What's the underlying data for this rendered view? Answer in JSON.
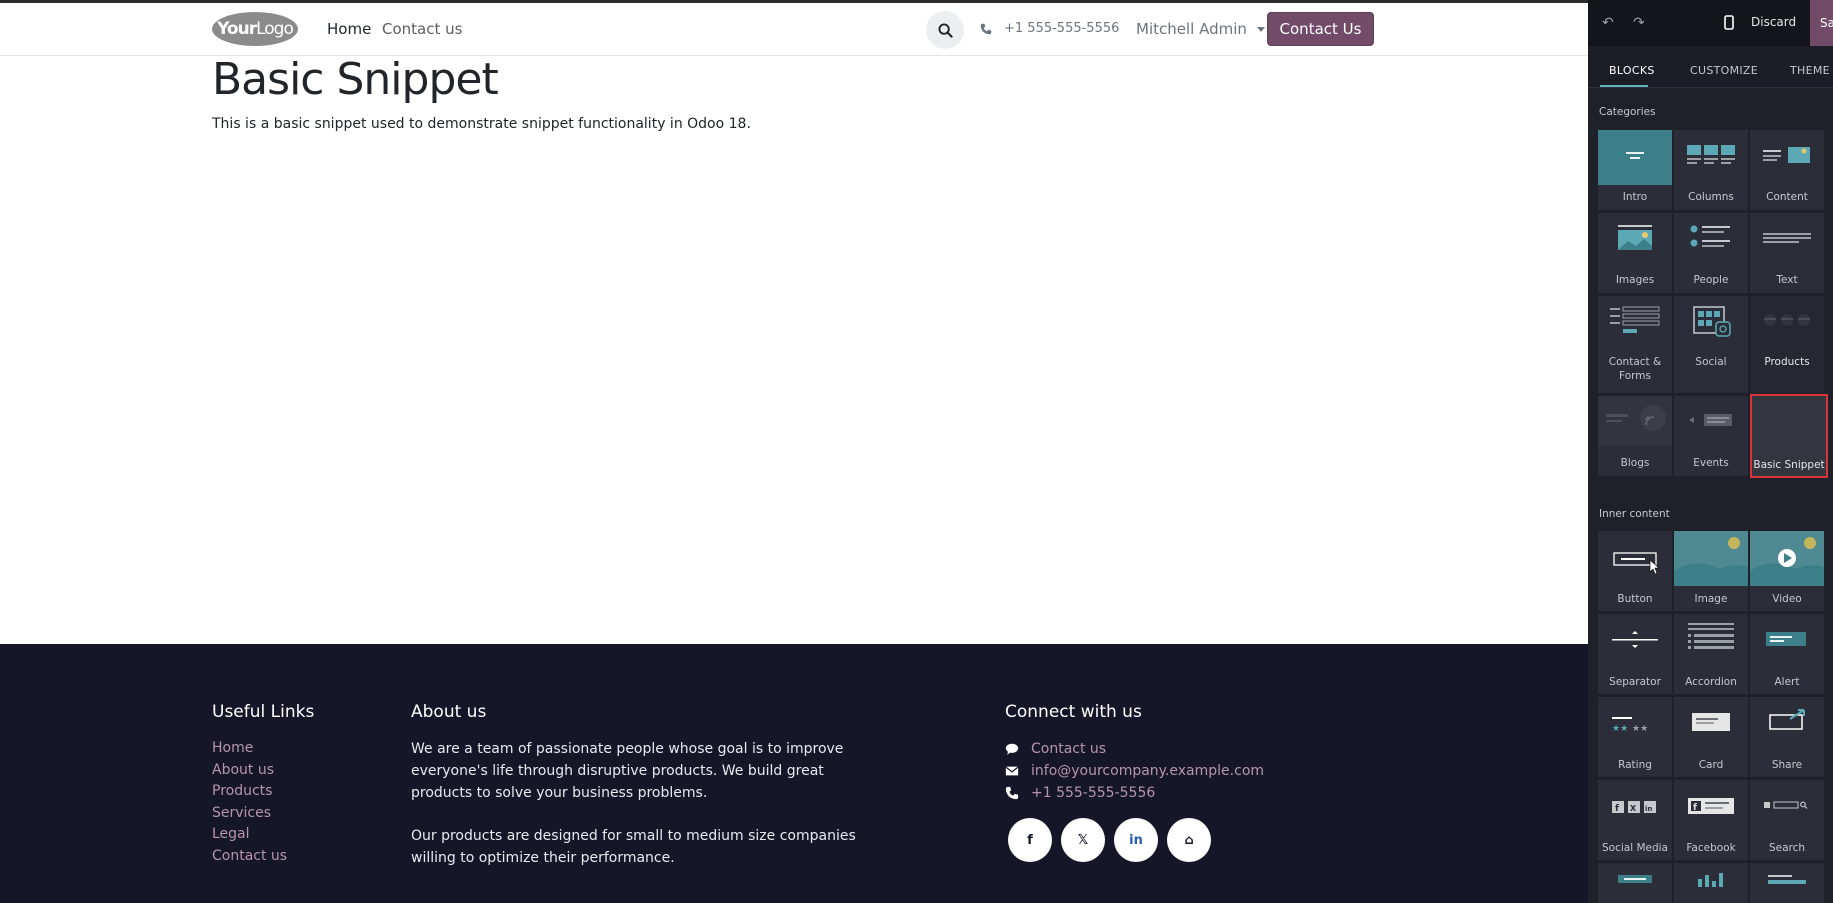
{
  "header": {
    "logo": {
      "bold": "Your",
      "rest": "Logo"
    },
    "nav": [
      {
        "label": "Home"
      },
      {
        "label": "Contact us"
      }
    ],
    "phone": "+1 555-555-5556",
    "user": "Mitchell Admin",
    "cta": "Contact Us"
  },
  "content": {
    "title": "Basic Snippet",
    "text": "This is a basic snippet used to demonstrate snippet functionality in Odoo 18."
  },
  "footer": {
    "useful_links_title": "Useful Links",
    "links": [
      "Home",
      "About us",
      "Products",
      "Services",
      "Legal",
      "Contact us"
    ],
    "about_title": "About us",
    "about_p1": "We are a team of passionate people whose goal is to improve everyone's life through disruptive products. We build great products to solve your business problems.",
    "about_p2": "Our products are designed for small to medium size companies willing to optimize their performance.",
    "connect_title": "Connect with us",
    "contact_link": "Contact us",
    "email": "info@yourcompany.example.com",
    "phone": "+1 555-555-5556",
    "socials": [
      "f",
      "𝕏",
      "in",
      "⌂"
    ]
  },
  "panel": {
    "discard": "Discard",
    "save": "Save",
    "tabs": [
      "BLOCKS",
      "CUSTOMIZE",
      "THEME"
    ],
    "categories_title": "Categories",
    "categories": [
      "Intro",
      "Columns",
      "Content",
      "Images",
      "People",
      "Text",
      "Contact & Forms",
      "Social",
      "Products",
      "Blogs",
      "Events",
      "Basic Snippet"
    ],
    "inner_title": "Inner content",
    "inner": [
      "Button",
      "Image",
      "Video",
      "Separator",
      "Accordion",
      "Alert",
      "Rating",
      "Card",
      "Share",
      "Social Media",
      "Facebook",
      "Search"
    ]
  },
  "colors": {
    "brand": "#714b67",
    "footer_bg": "#151728",
    "panel_bg": "#1f2129",
    "accent": "#5fb3be",
    "selected": "#d9353b"
  }
}
